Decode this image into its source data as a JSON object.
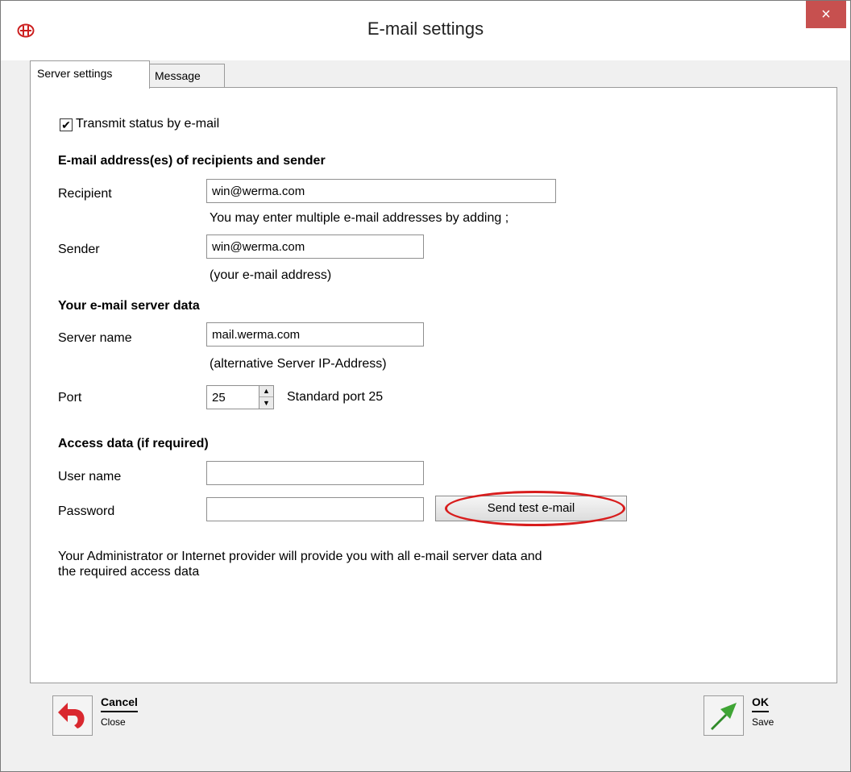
{
  "window": {
    "title": "E-mail settings",
    "close_glyph": "×"
  },
  "tabs": [
    {
      "label": "Server settings",
      "active": true
    },
    {
      "label": "Message",
      "active": false
    }
  ],
  "server_settings": {
    "transmit_checkbox": {
      "label": "Transmit status by e-mail",
      "checked": true,
      "check_glyph": "✔"
    },
    "recipients_section": {
      "heading": "E-mail address(es) of recipients and sender",
      "recipient": {
        "label": "Recipient",
        "value": "win@werma.com",
        "hint": "You may enter multiple e-mail addresses by adding ;"
      },
      "sender": {
        "label": "Sender",
        "value": "win@werma.com",
        "hint": "(your e-mail address)"
      }
    },
    "server_section": {
      "heading": "Your e-mail server data",
      "server_name": {
        "label": "Server name",
        "value": "mail.werma.com",
        "hint": "(alternative Server IP-Address)"
      },
      "port": {
        "label": "Port",
        "value": "25",
        "hint": "Standard port 25",
        "up_glyph": "▲",
        "down_glyph": "▼"
      }
    },
    "access_section": {
      "heading": "Access data (if required)",
      "user_name": {
        "label": "User name",
        "value": ""
      },
      "password": {
        "label": "Password",
        "value": ""
      },
      "test_button": "Send test e-mail"
    },
    "info_line_1": "Your Administrator or Internet provider will provide you with all e-mail server data and",
    "info_line_2": "the required access data"
  },
  "footer": {
    "cancel": {
      "label": "Cancel",
      "sublabel": "Close",
      "icon": "undo-arrow-icon",
      "color": "#d9282f"
    },
    "ok": {
      "label": "OK",
      "sublabel": "Save",
      "icon": "up-right-arrow-icon",
      "color": "#3fa535"
    }
  },
  "colors": {
    "close_button": "#c7504f",
    "highlight": "#d81d1d"
  }
}
